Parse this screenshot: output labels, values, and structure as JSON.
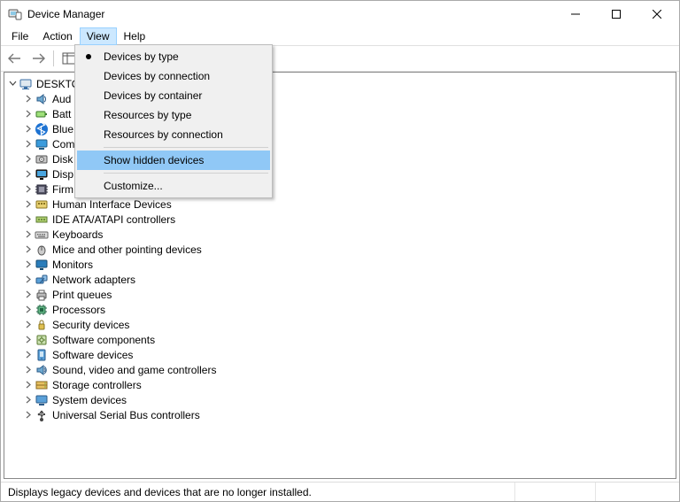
{
  "window": {
    "title": "Device Manager"
  },
  "menubar": {
    "items": [
      {
        "label": "File"
      },
      {
        "label": "Action"
      },
      {
        "label": "View"
      },
      {
        "label": "Help"
      }
    ],
    "active_index": 2
  },
  "dropdown": {
    "items": [
      {
        "label": "Devices by type",
        "radio": true
      },
      {
        "label": "Devices by connection"
      },
      {
        "label": "Devices by container"
      },
      {
        "label": "Resources by type"
      },
      {
        "label": "Resources by connection"
      },
      {
        "sep": true
      },
      {
        "label": "Show hidden devices",
        "highlight": true
      },
      {
        "sep": true
      },
      {
        "label": "Customize..."
      }
    ]
  },
  "tree": {
    "root_label": "DESKTO",
    "items": [
      {
        "label": "Aud",
        "icon": "audio"
      },
      {
        "label": "Batt",
        "icon": "battery"
      },
      {
        "label": "Blue",
        "icon": "bluetooth"
      },
      {
        "label": "Com",
        "icon": "computer"
      },
      {
        "label": "Disk",
        "icon": "disk"
      },
      {
        "label": "Disp",
        "icon": "display"
      },
      {
        "label": "Firm",
        "icon": "firmware"
      },
      {
        "label": "Human Interface Devices",
        "icon": "hid"
      },
      {
        "label": "IDE ATA/ATAPI controllers",
        "icon": "ide"
      },
      {
        "label": "Keyboards",
        "icon": "keyboard"
      },
      {
        "label": "Mice and other pointing devices",
        "icon": "mouse"
      },
      {
        "label": "Monitors",
        "icon": "monitor"
      },
      {
        "label": "Network adapters",
        "icon": "network"
      },
      {
        "label": "Print queues",
        "icon": "printer"
      },
      {
        "label": "Processors",
        "icon": "cpu"
      },
      {
        "label": "Security devices",
        "icon": "security"
      },
      {
        "label": "Software components",
        "icon": "swcomp"
      },
      {
        "label": "Software devices",
        "icon": "swdev"
      },
      {
        "label": "Sound, video and game controllers",
        "icon": "sound"
      },
      {
        "label": "Storage controllers",
        "icon": "storage"
      },
      {
        "label": "System devices",
        "icon": "system"
      },
      {
        "label": "Universal Serial Bus controllers",
        "icon": "usb"
      }
    ]
  },
  "statusbar": {
    "text": "Displays legacy devices and devices that are no longer installed."
  },
  "icons": {
    "app": "device-manager-icon"
  }
}
